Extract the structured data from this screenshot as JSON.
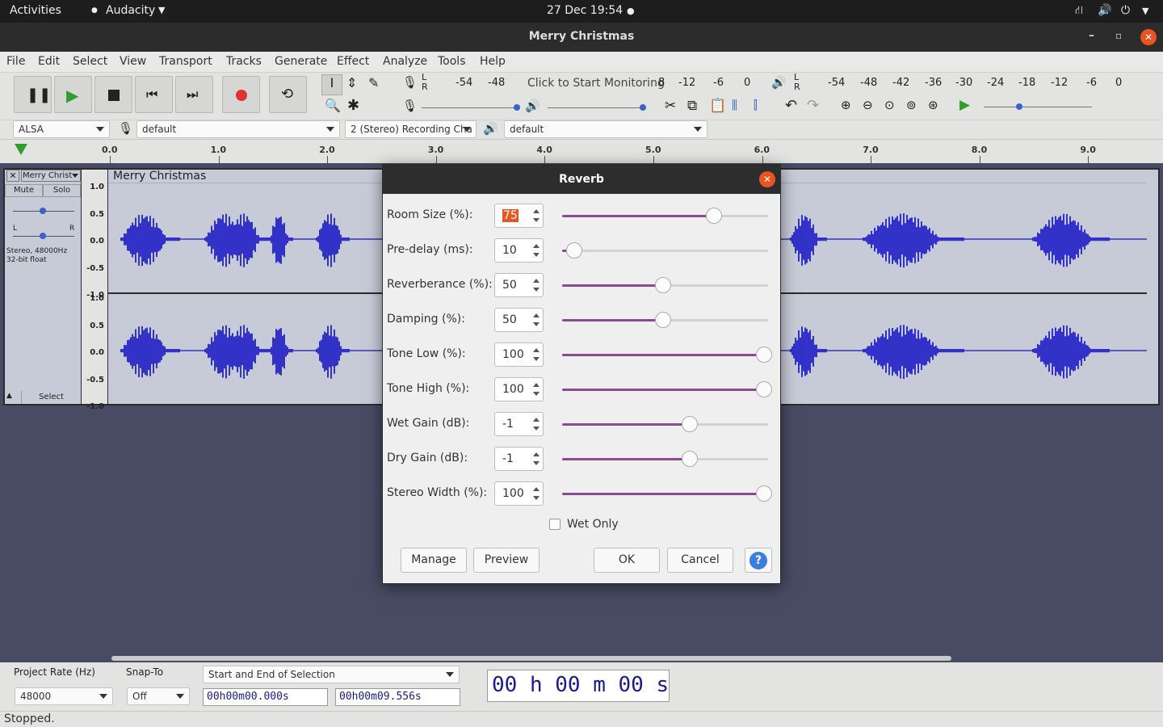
{
  "topbar": {
    "activities": "Activities",
    "app": "Audacity",
    "clock": "27 Dec  19:54"
  },
  "window": {
    "title": "Merry Christmas"
  },
  "menu": [
    "File",
    "Edit",
    "Select",
    "View",
    "Transport",
    "Tracks",
    "Generate",
    "Effect",
    "Analyze",
    "Tools",
    "Help"
  ],
  "meter": {
    "rec_text": "Click to Start Monitoring",
    "ticks_rec": [
      "-54",
      "-48",
      "8",
      "-12",
      "-6",
      "0"
    ],
    "ticks_play": [
      "-54",
      "-48",
      "-42",
      "-36",
      "-30",
      "-24",
      "-18",
      "-12",
      "-6",
      "0"
    ],
    "lr": [
      "L",
      "R"
    ]
  },
  "devices": {
    "host": "ALSA",
    "rec_device": "default",
    "channels": "2 (Stereo) Recording Cha",
    "play_device": "default"
  },
  "ruler": [
    "0.0",
    "1.0",
    "2.0",
    "3.0",
    "4.0",
    "5.0",
    "6.0",
    "7.0",
    "8.0",
    "9.0"
  ],
  "track": {
    "name": "Merry Christ",
    "clip_name": "Merry Christmas",
    "mute": "Mute",
    "solo": "Solo",
    "gain_l": "L",
    "gain_r": "R",
    "info1": "Stereo, 48000Hz",
    "info2": "32-bit float",
    "select": "Select",
    "scale": [
      "1.0",
      "0.5",
      "0.0",
      "-0.5",
      "-1.0"
    ]
  },
  "dialog": {
    "title": "Reverb",
    "params": [
      {
        "label": "Room Size (%):",
        "value": "75",
        "fraction": 0.75
      },
      {
        "label": "Pre-delay (ms):",
        "value": "10",
        "fraction": 0.06
      },
      {
        "label": "Reverberance (%):",
        "value": "50",
        "fraction": 0.5
      },
      {
        "label": "Damping (%):",
        "value": "50",
        "fraction": 0.5
      },
      {
        "label": "Tone Low (%):",
        "value": "100",
        "fraction": 1.0
      },
      {
        "label": "Tone High (%):",
        "value": "100",
        "fraction": 1.0
      },
      {
        "label": "Wet Gain (dB):",
        "value": "-1",
        "fraction": 0.63
      },
      {
        "label": "Dry Gain (dB):",
        "value": "-1",
        "fraction": 0.63
      },
      {
        "label": "Stereo Width (%):",
        "value": "100",
        "fraction": 1.0
      }
    ],
    "wet_only": "Wet Only",
    "manage": "Manage",
    "preview": "Preview",
    "ok": "OK",
    "cancel": "Cancel",
    "help": "?"
  },
  "selection": {
    "rate_label": "Project Rate (Hz)",
    "rate": "48000",
    "snap_label": "Snap-To",
    "snap": "Off",
    "mode": "Start and End of Selection",
    "start": "00h00m00.000s",
    "end": "00h00m09.556s",
    "position": "00 h 00 m 00 s"
  },
  "status": "Stopped.",
  "colors": {
    "accent": "#8c4a92",
    "wave": "#3232c8",
    "close": "#e95420"
  }
}
